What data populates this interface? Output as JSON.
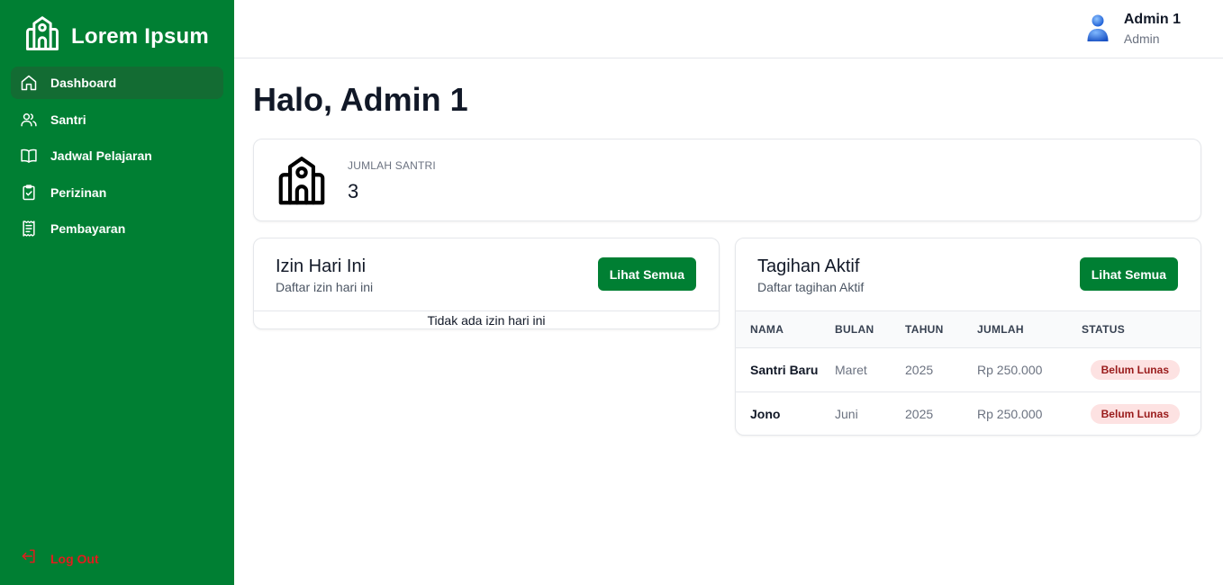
{
  "brand": {
    "name": "Lorem Ipsum",
    "icon": "school-icon"
  },
  "sidebar": {
    "items": [
      {
        "label": "Dashboard",
        "icon": "home-icon",
        "active": true
      },
      {
        "label": "Santri",
        "icon": "users-icon"
      },
      {
        "label": "Jadwal Pelajaran",
        "icon": "book-open-icon"
      },
      {
        "label": "Perizinan",
        "icon": "clipboard-check-icon"
      },
      {
        "label": "Pembayaran",
        "icon": "receipt-icon"
      }
    ],
    "logout": {
      "label": "Log Out",
      "icon": "logout-icon"
    }
  },
  "header": {
    "user_name": "Admin 1",
    "user_role": "Admin",
    "avatar": "user-avatar-icon"
  },
  "main": {
    "greeting": "Halo, Admin 1",
    "stat": {
      "label": "JUMLAH SANTRI",
      "value": "3",
      "icon": "school-icon"
    },
    "izin": {
      "title": "Izin Hari Ini",
      "subtitle": "Daftar izin hari ini",
      "button": "Lihat Semua",
      "empty": "Tidak ada izin hari ini"
    },
    "tagihan": {
      "title": "Tagihan Aktif",
      "subtitle": "Daftar tagihan Aktif",
      "button": "Lihat Semua",
      "columns": [
        "NAMA",
        "BULAN",
        "TAHUN",
        "JUMLAH",
        "STATUS"
      ],
      "rows": [
        {
          "nama": "Santri Baru",
          "bulan": "Maret",
          "tahun": "2025",
          "jumlah": "Rp 250.000",
          "status": "Belum Lunas"
        },
        {
          "nama": "Jono",
          "bulan": "Juni",
          "tahun": "2025",
          "jumlah": "Rp 250.000",
          "status": "Belum Lunas"
        }
      ]
    }
  },
  "colors": {
    "primary": "#007f33",
    "sidebar_active": "#136c33",
    "danger": "#e11d1d",
    "badge_bg": "#fde2e2",
    "badge_text": "#991b1b"
  }
}
